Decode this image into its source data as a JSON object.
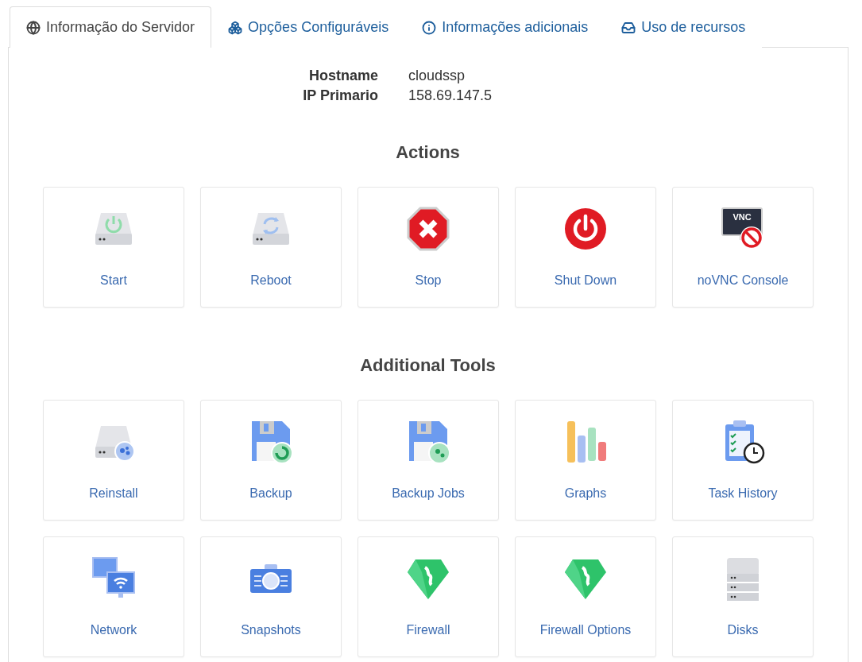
{
  "tabs": [
    {
      "label": "Informação do Servidor",
      "kind": "globe",
      "selected": true
    },
    {
      "label": "Opções Configuráveis",
      "kind": "cubes",
      "selected": false
    },
    {
      "label": "Informações adicionais",
      "kind": "info",
      "selected": false
    },
    {
      "label": "Uso de recursos",
      "kind": "inbox",
      "selected": false
    }
  ],
  "server_info": [
    {
      "label": "Hostname",
      "value": "cloudssp"
    },
    {
      "label": "IP Primario",
      "value": "158.69.147.5"
    }
  ],
  "sections": [
    {
      "title": "Actions",
      "tiles": [
        {
          "label": "Start",
          "kind": "start"
        },
        {
          "label": "Reboot",
          "kind": "reboot"
        },
        {
          "label": "Stop",
          "kind": "stop"
        },
        {
          "label": "Shut Down",
          "kind": "shutdown"
        },
        {
          "label": "noVNC Console",
          "kind": "vnc",
          "badge": "VNC"
        }
      ]
    },
    {
      "title": "Additional Tools",
      "tiles": [
        {
          "label": "Reinstall",
          "kind": "reinstall"
        },
        {
          "label": "Backup",
          "kind": "backup"
        },
        {
          "label": "Backup Jobs",
          "kind": "backupjobs"
        },
        {
          "label": "Graphs",
          "kind": "graphs"
        },
        {
          "label": "Task History",
          "kind": "tasks"
        },
        {
          "label": "Network",
          "kind": "network"
        },
        {
          "label": "Snapshots",
          "kind": "snapshots"
        },
        {
          "label": "Firewall",
          "kind": "firewall"
        },
        {
          "label": "Firewall Options",
          "kind": "firewall"
        },
        {
          "label": "Disks",
          "kind": "disks"
        }
      ]
    }
  ]
}
